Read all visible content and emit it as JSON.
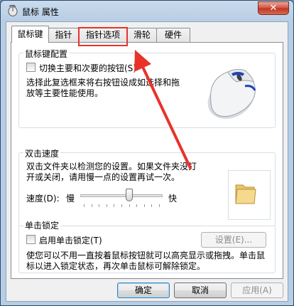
{
  "window": {
    "title": "鼠标 属性",
    "close_glyph": "✕"
  },
  "tabs": [
    {
      "label": "鼠标键",
      "active": true
    },
    {
      "label": "指针",
      "active": false
    },
    {
      "label": "指针选项",
      "active": false
    },
    {
      "label": "滑轮",
      "active": false
    },
    {
      "label": "硬件",
      "active": false
    }
  ],
  "button_config": {
    "title": "鼠标键配置",
    "switch_label": "切换主要和次要的按钮(S)",
    "switch_checked": false,
    "description": "选择此复选框来将右按钮设成如选择和拖放等主要性能使用。"
  },
  "double_click": {
    "title": "双击速度",
    "description": "双击文件夹以检测您的设置。如果文件夹没打开或关闭，请用慢一点的设置再试一次。",
    "speed_label": "速度(D):",
    "slow_label": "慢",
    "fast_label": "快",
    "speed_value": 0.6
  },
  "click_lock": {
    "title": "单击锁定",
    "enable_label": "启用单击锁定(T)",
    "enable_checked": false,
    "settings_button": "设置(E)...",
    "description": "使您可以不用一直按着鼠标按钮就可以高亮显示或拖拽。单击鼠标以进入锁定状态，再次单击鼠标可解除锁定。"
  },
  "footer": {
    "ok": "确定",
    "cancel": "取消",
    "apply": "应用(A)"
  },
  "colors": {
    "annotation": "#e8332b",
    "accent": "#3c7fb1"
  }
}
